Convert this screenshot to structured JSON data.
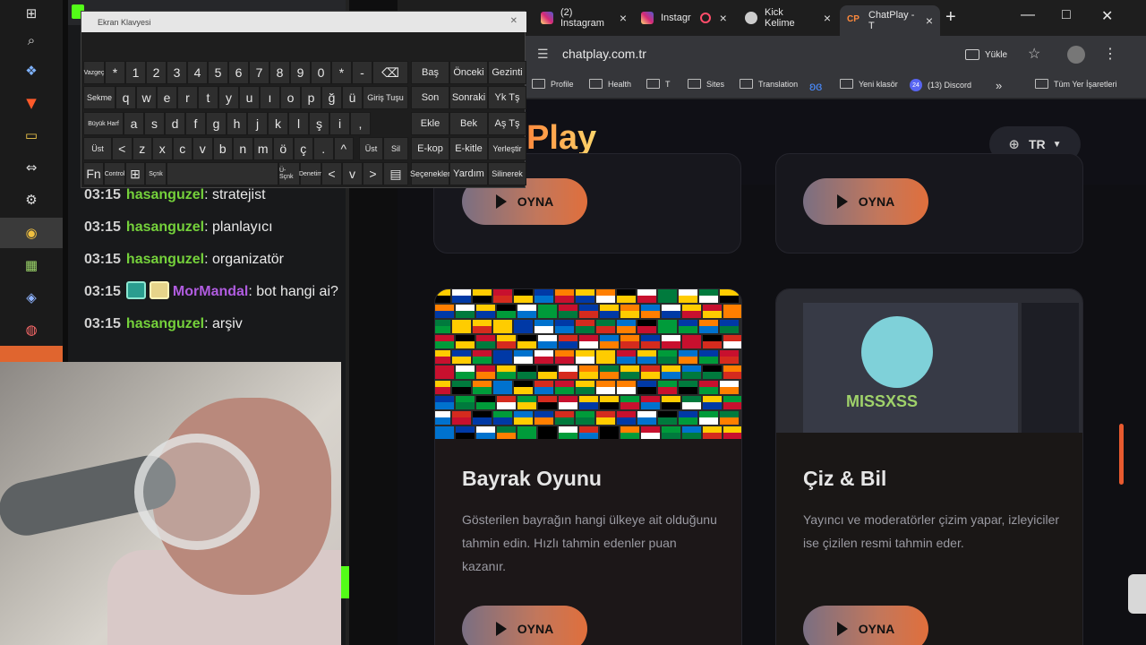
{
  "taskbar": {
    "icons": [
      "windows-start-icon",
      "search-icon",
      "copilot-icon",
      "brave-icon",
      "file-explorer-icon",
      "remote-desktop-icon",
      "settings-icon",
      "chrome-icon",
      "app-icon",
      "tool-icon",
      "app-icon"
    ]
  },
  "chat": {
    "messages": [
      {
        "time": "03:15",
        "user": "hasanguzel",
        "sep": ":",
        "text": " stratejist"
      },
      {
        "time": "03:15",
        "user": "hasanguzel",
        "sep": ":",
        "text": " planlayıcı"
      },
      {
        "time": "03:15",
        "user": "hasanguzel",
        "sep": ":",
        "text": " organizatör"
      },
      {
        "time": "03:15",
        "user": "MorMandal",
        "sep": ":",
        "text": " bot hangi ai?"
      },
      {
        "time": "03:15",
        "user": "hasanguzel",
        "sep": ":",
        "text": " arşiv"
      }
    ]
  },
  "keyboard": {
    "title": "Ekran Klavyesi",
    "row1": [
      "Vazgeç",
      "*",
      "1",
      "2",
      "3",
      "4",
      "5",
      "6",
      "7",
      "8",
      "9",
      "0",
      "*",
      "-",
      "⌫"
    ],
    "row2": [
      "Sekme",
      "q",
      "w",
      "e",
      "r",
      "t",
      "y",
      "u",
      "ı",
      "o",
      "p",
      "ğ",
      "ü",
      "Giriş Tuşu"
    ],
    "row3": [
      "Büyük Harf",
      "a",
      "s",
      "d",
      "f",
      "g",
      "h",
      "j",
      "k",
      "l",
      "ş",
      "i",
      ","
    ],
    "row4": [
      "Üst",
      "<",
      "z",
      "x",
      "c",
      "v",
      "b",
      "n",
      "m",
      "ö",
      "ç",
      ".",
      "^",
      "Üst",
      "Sil"
    ],
    "row5": [
      "Fn",
      "Control",
      "⊞",
      "Sçnk",
      "",
      "Ü-Sçnk",
      "Denetim",
      "<",
      "v",
      ">",
      "▤"
    ],
    "side": [
      [
        "Baş",
        "Önceki",
        "Gezinti"
      ],
      [
        "Son",
        "Sonraki",
        "Yk Tş"
      ],
      [
        "Ekle",
        "Bek",
        "Aş Tş"
      ],
      [
        "E-kop",
        "E-kitle",
        "Yerleştir"
      ],
      [
        "Seçenekler",
        "Yardım",
        "Silinerek"
      ]
    ]
  },
  "browser": {
    "tabs": [
      {
        "label": "(2) Instagram",
        "fav": "instagram-icon"
      },
      {
        "label": "Instagr",
        "fav": "instagram-icon"
      },
      {
        "label": "Kick Kelime",
        "fav": "kick-icon"
      },
      {
        "label": "ChatPlay - T",
        "fav": "CP"
      }
    ],
    "url": "chatplay.com.tr",
    "install_label": "Yükle",
    "bookmarks": [
      "Profile",
      "Health",
      "T",
      "Sites",
      "Translation",
      "",
      "Yeni klasör",
      "(13) Discord",
      "»",
      "Tüm Yer İşaretleri"
    ],
    "discord_badge": "24"
  },
  "page": {
    "logo": "Play",
    "lang": "TR",
    "play_label": "OYNA",
    "cards": [
      {
        "title": "Bayrak Oyunu",
        "desc": "Gösterilen bayrağın hangi ülkeye ait olduğunu tahmin edin. Hızlı tahmin edenler puan kazanır."
      },
      {
        "title": "Çiz & Bil",
        "desc": "Yayıncı ve moderatörler çizim yapar, izleyiciler ise çizilen resmi tahmin eder."
      }
    ],
    "canvas_label": "MISSXSS",
    "colors": {
      "accent_start": "#ff8a3d",
      "accent_end": "#ffd56b",
      "card_bg": "#17171d",
      "kick_green": "#53fc18"
    }
  }
}
